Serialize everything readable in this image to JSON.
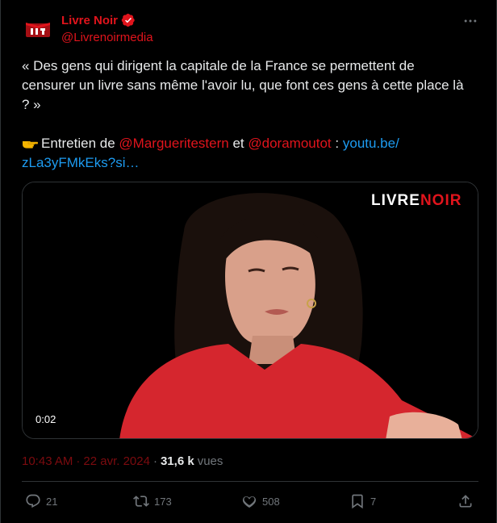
{
  "author": {
    "display_name": "Livre Noir",
    "handle": "@Livrenoirmedia",
    "avatar_icon": "livre-noir-logo-icon",
    "verified_icon": "verified-badge-icon"
  },
  "tweet": {
    "line1": "« Des gens qui dirigent la capitale de la France se permettent de",
    "line2": "censurer un livre sans même l'avoir lu, que font ces gens à cette place là",
    "line3": "? »",
    "line4_prefix": "Entretien de",
    "mention1": "@Margueritestern",
    "and_word": "et",
    "mention2": "@doramoutot",
    "colon": ":",
    "link_part1": "youtu.be/",
    "link_part2": "zLa3yFMkEks?si…"
  },
  "media": {
    "logo_white_a": "LIVRE",
    "logo_red": "NOIR",
    "duration": "0:02"
  },
  "meta": {
    "time": "10:43 AM",
    "separator1": "·",
    "date": "22 avr. 2024",
    "separator2": "·",
    "views_count": "31,6 k",
    "views_label": "vues"
  },
  "actions": {
    "replies": "21",
    "reposts": "173",
    "likes": "508",
    "bookmarks": "7"
  },
  "colors": {
    "brand_red": "#e0141c",
    "link_blue": "#1d9bf0",
    "muted": "#71767b"
  }
}
